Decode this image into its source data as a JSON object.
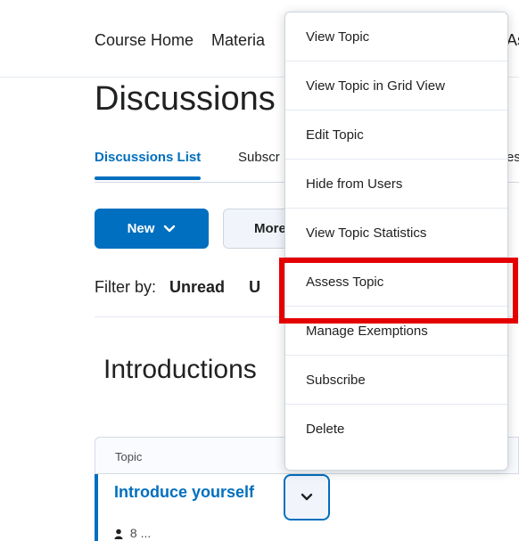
{
  "topnav": {
    "items": [
      {
        "label": "Course Home"
      },
      {
        "label": "Materia"
      },
      {
        "label": "As"
      }
    ]
  },
  "page": {
    "title": "Discussions"
  },
  "tabs": [
    {
      "label": "Discussions List",
      "active": true
    },
    {
      "label": "Subscr"
    },
    {
      "label": "es"
    }
  ],
  "toolbar": {
    "new_label": "New",
    "more_label": "More"
  },
  "filter": {
    "label": "Filter by:",
    "options": [
      "Unread",
      "U"
    ]
  },
  "section": {
    "heading": "Introductions"
  },
  "table": {
    "header": "Topic",
    "row": {
      "title": "Introduce yourself",
      "sub": "8 ..."
    }
  },
  "menu": {
    "items": [
      {
        "label": "View Topic"
      },
      {
        "label": "View Topic in Grid View"
      },
      {
        "label": "Edit Topic"
      },
      {
        "label": "Hide from Users"
      },
      {
        "label": "View Topic Statistics"
      },
      {
        "label": "Assess Topic",
        "highlighted": true
      },
      {
        "label": "Manage Exemptions"
      },
      {
        "label": "Subscribe"
      },
      {
        "label": "Delete"
      }
    ]
  },
  "colors": {
    "accent": "#006fbf",
    "highlight": "#e50000",
    "text": "#202122"
  },
  "icons": {
    "new_chevron": "chevron-down-icon",
    "row_menu": "chevron-down-icon",
    "author": "person-icon"
  }
}
